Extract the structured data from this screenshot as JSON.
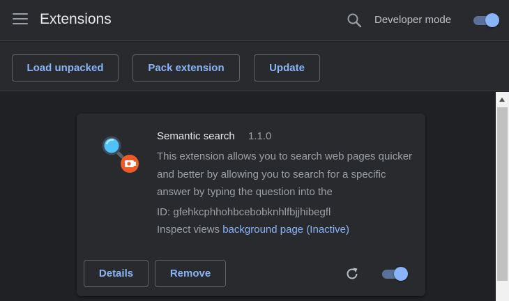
{
  "header": {
    "title": "Extensions",
    "developer_mode_label": "Developer mode",
    "developer_mode_on": true
  },
  "toolbar": {
    "load_unpacked_label": "Load unpacked",
    "pack_extension_label": "Pack extension",
    "update_label": "Update"
  },
  "extension": {
    "name": "Semantic search",
    "version": "1.1.0",
    "description": "This extension allows you to search web pages quicker and better by allowing you to search for a specific answer by typing the question into the",
    "id_label": "ID: gfehkcphhohbcebobknhlfbjjhibegfl",
    "inspect_label": "Inspect views",
    "inspect_link": "background page (Inactive)",
    "details_label": "Details",
    "remove_label": "Remove",
    "enabled": true,
    "icons": {
      "main": "magnifier-icon",
      "badge": "camera-badge-icon",
      "reload": "reload-icon"
    }
  },
  "colors": {
    "background": "#202124",
    "surface": "#292a2d",
    "accent": "#8ab4f8",
    "badge": "#f05a28"
  }
}
